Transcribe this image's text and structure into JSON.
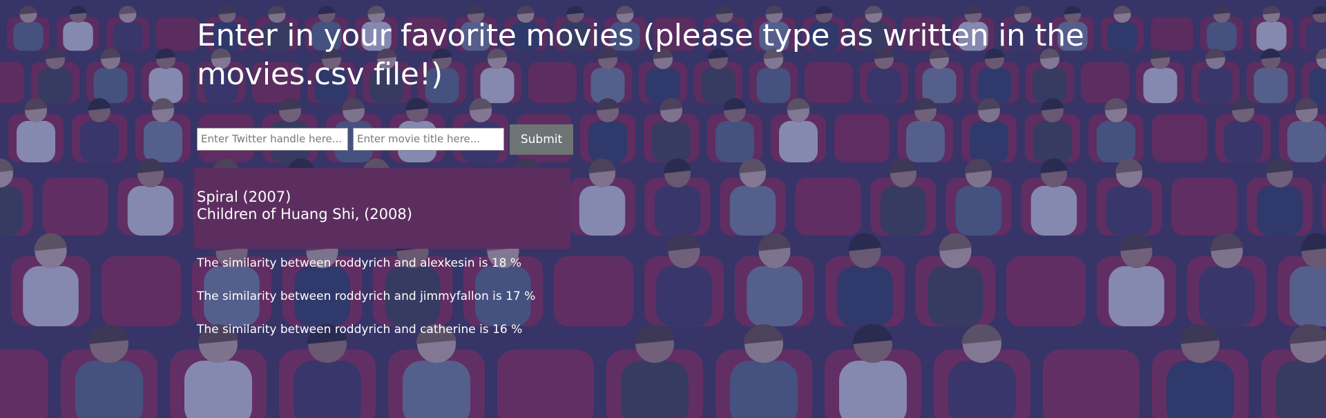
{
  "page": {
    "title": "Enter in your favorite movies (please type as written in the movies.csv file!)"
  },
  "form": {
    "twitter_placeholder": "Enter Twitter handle here...",
    "movie_placeholder": "Enter movie title here...",
    "submit_label": "Submit"
  },
  "results": {
    "movies": [
      "Spiral (2007)",
      "Children of Huang Shi, (2008)"
    ]
  },
  "similarities": [
    "The similarity between roddyrich and alexkesin is 18 %",
    "The similarity between roddyrich and jimmyfallon is 17 %",
    "The similarity between roddyrich and catherine is 16 %"
  ],
  "colors": {
    "overlay": "#343c82",
    "results_box": "#5c2e5f",
    "submit_button": "#6c7574",
    "text": "#ffffff"
  }
}
